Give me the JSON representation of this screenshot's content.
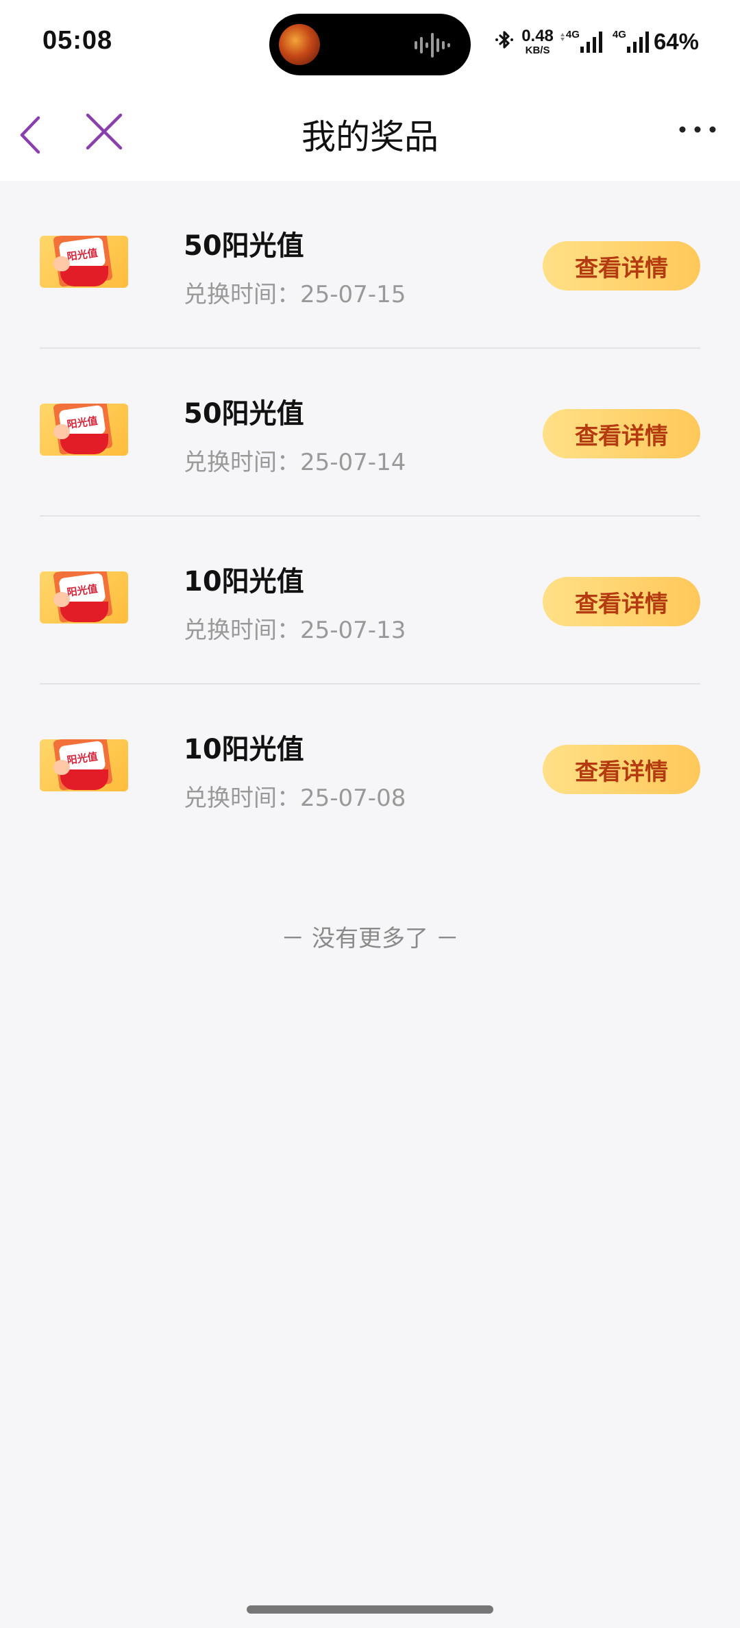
{
  "status_bar": {
    "time": "05:08",
    "net_speed_value": "0.48",
    "net_speed_unit": "KB/S",
    "signal_1_label": "4G",
    "signal_2_label": "4G",
    "battery": "64%"
  },
  "nav": {
    "title": "我的奖品"
  },
  "prizes": [
    {
      "name": "50阳光值",
      "date": "兑换时间：25-07-15",
      "button": "查看详情",
      "thumb_label": "阳光值"
    },
    {
      "name": "50阳光值",
      "date": "兑换时间：25-07-14",
      "button": "查看详情",
      "thumb_label": "阳光值"
    },
    {
      "name": "10阳光值",
      "date": "兑换时间：25-07-13",
      "button": "查看详情",
      "thumb_label": "阳光值"
    },
    {
      "name": "10阳光值",
      "date": "兑换时间：25-07-08",
      "button": "查看详情",
      "thumb_label": "阳光值"
    }
  ],
  "list_end_text": "－ 没有更多了 －",
  "colors": {
    "nav_icon": "#8b3fae",
    "button_text": "#b43a10",
    "page_bg": "#f6f6f8"
  }
}
